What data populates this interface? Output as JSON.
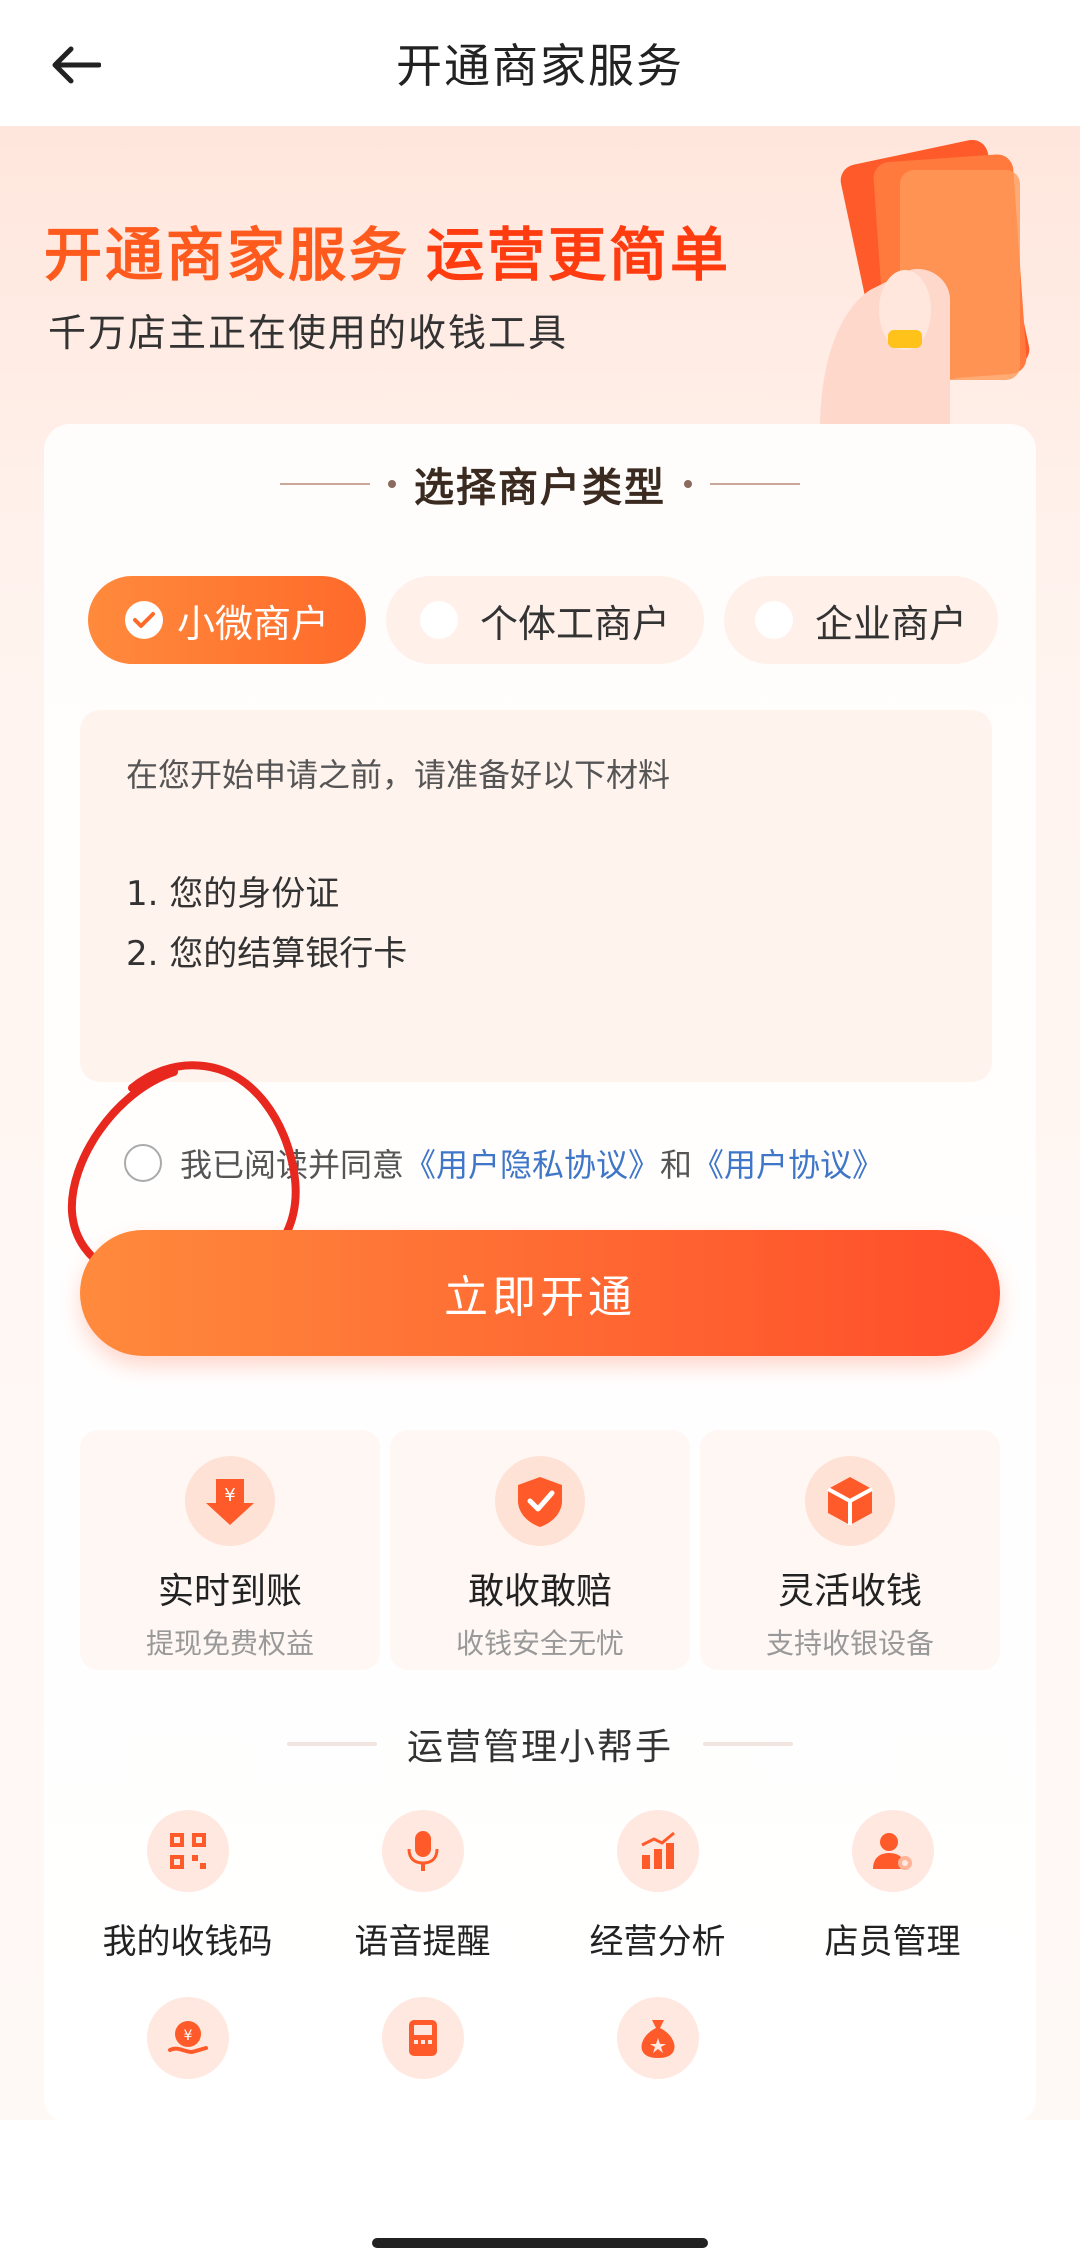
{
  "header": {
    "title": "开通商家服务"
  },
  "hero": {
    "title_a": "开通商家服务",
    "title_b": "运营更简单",
    "subtitle": "千万店主正在使用的收钱工具"
  },
  "merchant_type": {
    "section_title": "选择商户类型",
    "tabs": [
      {
        "label": "小微商户",
        "selected": true
      },
      {
        "label": "个体工商户",
        "selected": false
      },
      {
        "label": "企业商户",
        "selected": false
      }
    ]
  },
  "materials": {
    "intro": "在您开始申请之前，请准备好以下材料",
    "items": [
      "1. 您的身份证",
      "2. 您的结算银行卡"
    ]
  },
  "agreement": {
    "prefix": "我已阅读并同意",
    "link1": "《用户隐私协议》",
    "conjunction": "和",
    "link2": "《用户协议》",
    "checked": false
  },
  "cta": {
    "label": "立即开通"
  },
  "features": [
    {
      "title": "实时到账",
      "subtitle": "提现免费权益",
      "icon": "yen-arrow-down-icon"
    },
    {
      "title": "敢收敢赔",
      "subtitle": "收钱安全无忧",
      "icon": "shield-check-icon"
    },
    {
      "title": "灵活收钱",
      "subtitle": "支持收银设备",
      "icon": "cube-icon"
    }
  ],
  "helpers": {
    "title": "运营管理小帮手",
    "items": [
      {
        "label": "我的收钱码",
        "icon": "qr-code-icon"
      },
      {
        "label": "语音提醒",
        "icon": "microphone-icon"
      },
      {
        "label": "经营分析",
        "icon": "bar-chart-icon"
      },
      {
        "label": "店员管理",
        "icon": "staff-gear-icon"
      },
      {
        "label": "",
        "icon": "coin-hand-icon"
      },
      {
        "label": "",
        "icon": "device-icon"
      },
      {
        "label": "",
        "icon": "money-bag-icon"
      }
    ]
  },
  "colors": {
    "accent": "#ff6a2a",
    "link": "#3f76c7",
    "annotation": "#e8281e"
  }
}
